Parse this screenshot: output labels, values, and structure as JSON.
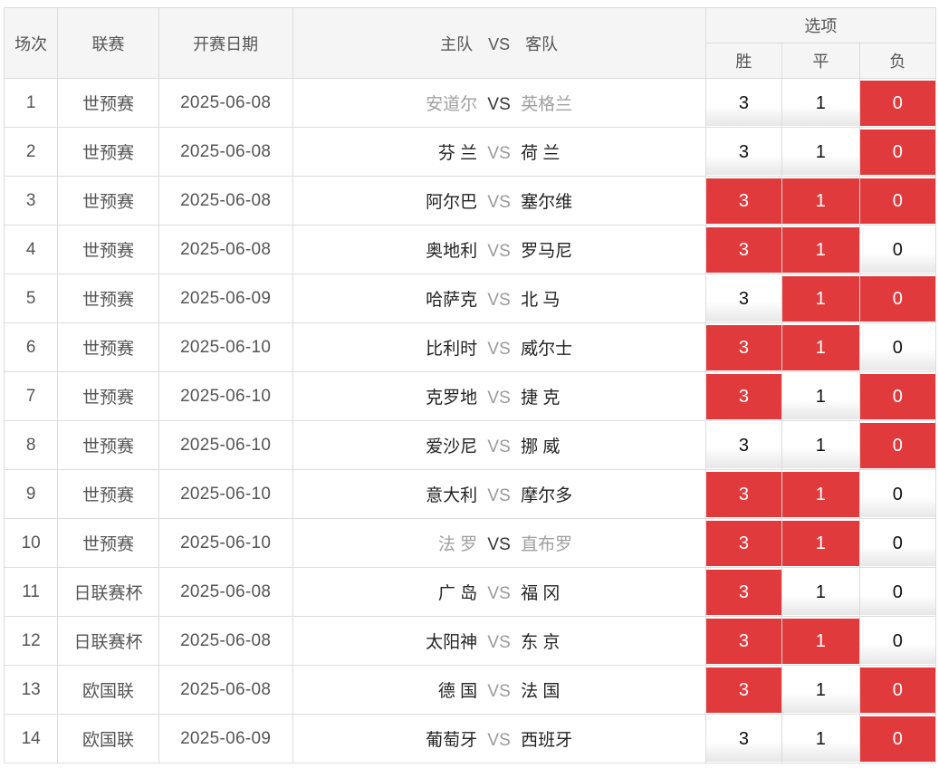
{
  "header": {
    "no": "场次",
    "league": "联赛",
    "date": "开赛日期",
    "home": "主队",
    "vs": "VS",
    "away": "客队",
    "options": "选项",
    "win": "胜",
    "draw": "平",
    "lose": "负"
  },
  "rows": [
    {
      "no": "1",
      "league": "世预赛",
      "date": "2025-06-08",
      "home": "安道尔",
      "vs": "VS",
      "away": "英格兰",
      "dim": true,
      "win": "3",
      "draw": "1",
      "lose": "0",
      "sel": [
        false,
        false,
        true
      ]
    },
    {
      "no": "2",
      "league": "世预赛",
      "date": "2025-06-08",
      "home": "芬 兰",
      "vs": "VS",
      "away": "荷 兰",
      "dim": false,
      "win": "3",
      "draw": "1",
      "lose": "0",
      "sel": [
        false,
        false,
        true
      ]
    },
    {
      "no": "3",
      "league": "世预赛",
      "date": "2025-06-08",
      "home": "阿尔巴",
      "vs": "VS",
      "away": "塞尔维",
      "dim": false,
      "win": "3",
      "draw": "1",
      "lose": "0",
      "sel": [
        true,
        true,
        true
      ]
    },
    {
      "no": "4",
      "league": "世预赛",
      "date": "2025-06-08",
      "home": "奥地利",
      "vs": "VS",
      "away": "罗马尼",
      "dim": false,
      "win": "3",
      "draw": "1",
      "lose": "0",
      "sel": [
        true,
        true,
        false
      ]
    },
    {
      "no": "5",
      "league": "世预赛",
      "date": "2025-06-09",
      "home": "哈萨克",
      "vs": "VS",
      "away": "北 马",
      "dim": false,
      "win": "3",
      "draw": "1",
      "lose": "0",
      "sel": [
        false,
        true,
        true
      ]
    },
    {
      "no": "6",
      "league": "世预赛",
      "date": "2025-06-10",
      "home": "比利时",
      "vs": "VS",
      "away": "威尔士",
      "dim": false,
      "win": "3",
      "draw": "1",
      "lose": "0",
      "sel": [
        true,
        true,
        false
      ]
    },
    {
      "no": "7",
      "league": "世预赛",
      "date": "2025-06-10",
      "home": "克罗地",
      "vs": "VS",
      "away": "捷 克",
      "dim": false,
      "win": "3",
      "draw": "1",
      "lose": "0",
      "sel": [
        true,
        false,
        true
      ]
    },
    {
      "no": "8",
      "league": "世预赛",
      "date": "2025-06-10",
      "home": "爱沙尼",
      "vs": "VS",
      "away": "挪 威",
      "dim": false,
      "win": "3",
      "draw": "1",
      "lose": "0",
      "sel": [
        false,
        false,
        true
      ]
    },
    {
      "no": "9",
      "league": "世预赛",
      "date": "2025-06-10",
      "home": "意大利",
      "vs": "VS",
      "away": "摩尔多",
      "dim": false,
      "win": "3",
      "draw": "1",
      "lose": "0",
      "sel": [
        true,
        true,
        false
      ]
    },
    {
      "no": "10",
      "league": "世预赛",
      "date": "2025-06-10",
      "home": "法 罗",
      "vs": "VS",
      "away": "直布罗",
      "dim": true,
      "win": "3",
      "draw": "1",
      "lose": "0",
      "sel": [
        true,
        true,
        false
      ]
    },
    {
      "no": "11",
      "league": "日联赛杯",
      "date": "2025-06-08",
      "home": "广 岛",
      "vs": "VS",
      "away": "福 冈",
      "dim": false,
      "win": "3",
      "draw": "1",
      "lose": "0",
      "sel": [
        true,
        false,
        false
      ]
    },
    {
      "no": "12",
      "league": "日联赛杯",
      "date": "2025-06-08",
      "home": "太阳神",
      "vs": "VS",
      "away": "东 京",
      "dim": false,
      "win": "3",
      "draw": "1",
      "lose": "0",
      "sel": [
        true,
        true,
        false
      ]
    },
    {
      "no": "13",
      "league": "欧国联",
      "date": "2025-06-08",
      "home": "德 国",
      "vs": "VS",
      "away": "法 国",
      "dim": false,
      "win": "3",
      "draw": "1",
      "lose": "0",
      "sel": [
        true,
        false,
        true
      ]
    },
    {
      "no": "14",
      "league": "欧国联",
      "date": "2025-06-09",
      "home": "葡萄牙",
      "vs": "VS",
      "away": "西班牙",
      "dim": false,
      "win": "3",
      "draw": "1",
      "lose": "0",
      "sel": [
        false,
        false,
        true
      ]
    }
  ],
  "colors": {
    "selected": "#e03a3c",
    "header_bg": "#f5f5f5",
    "vs_text": "#9a9a9a"
  }
}
